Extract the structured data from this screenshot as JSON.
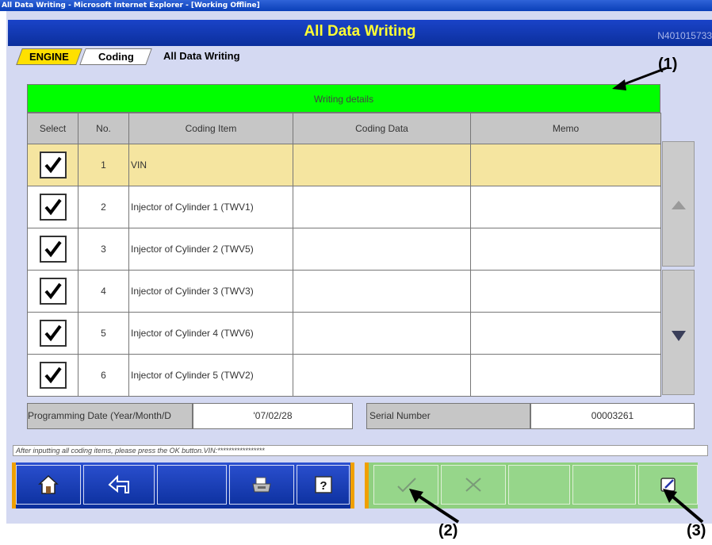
{
  "window": {
    "title": "All Data Writing - Microsoft Internet Explorer - [Working Offline]"
  },
  "header": {
    "title": "All Data Writing",
    "screen_id": "N401015733"
  },
  "breadcrumb": {
    "items": [
      "ENGINE",
      "Coding"
    ],
    "current": "All Data Writing"
  },
  "details": {
    "heading": "Writing details"
  },
  "table": {
    "columns": [
      "Select",
      "No.",
      "Coding Item",
      "Coding Data",
      "Memo"
    ],
    "rows": [
      {
        "no": "1",
        "item": "VIN",
        "checked": true,
        "selected": true
      },
      {
        "no": "2",
        "item": "Injector of Cylinder 1 (TWV1)",
        "checked": true
      },
      {
        "no": "3",
        "item": "Injector of Cylinder 2 (TWV5)",
        "checked": true
      },
      {
        "no": "4",
        "item": "Injector of Cylinder 3 (TWV3)",
        "checked": true
      },
      {
        "no": "5",
        "item": "Injector of Cylinder 4 (TWV6)",
        "checked": true
      },
      {
        "no": "6",
        "item": "Injector of Cylinder 5 (TWV2)",
        "checked": true
      }
    ]
  },
  "scroll": {
    "up_icon": "triangle-up-icon",
    "down_icon": "triangle-down-icon"
  },
  "info": {
    "programming_date_label": "Programming Date (Year/Month/D",
    "programming_date_value": "'07/02/28",
    "serial_label": "Serial Number",
    "serial_value": "00003261"
  },
  "status": {
    "message": "After inputting all coding items, please press the OK button.VIN:*****************"
  },
  "toolbar": {
    "left_icons": [
      "home-icon",
      "back-icon",
      "print-icon",
      "help-icon"
    ],
    "right_icons": [
      "ok-check-icon",
      "cancel-x-icon",
      "edit-icon"
    ]
  },
  "callouts": [
    "(1)",
    "(2)",
    "(3)"
  ],
  "colors": {
    "header_bg": "#0b2f9c",
    "header_text": "#ffff33",
    "details_bar": "#00ff00",
    "selected_row": "#f5e5a0",
    "breadcrumb_active": "#ffe000",
    "toolbar_accent": "#f0a000"
  }
}
